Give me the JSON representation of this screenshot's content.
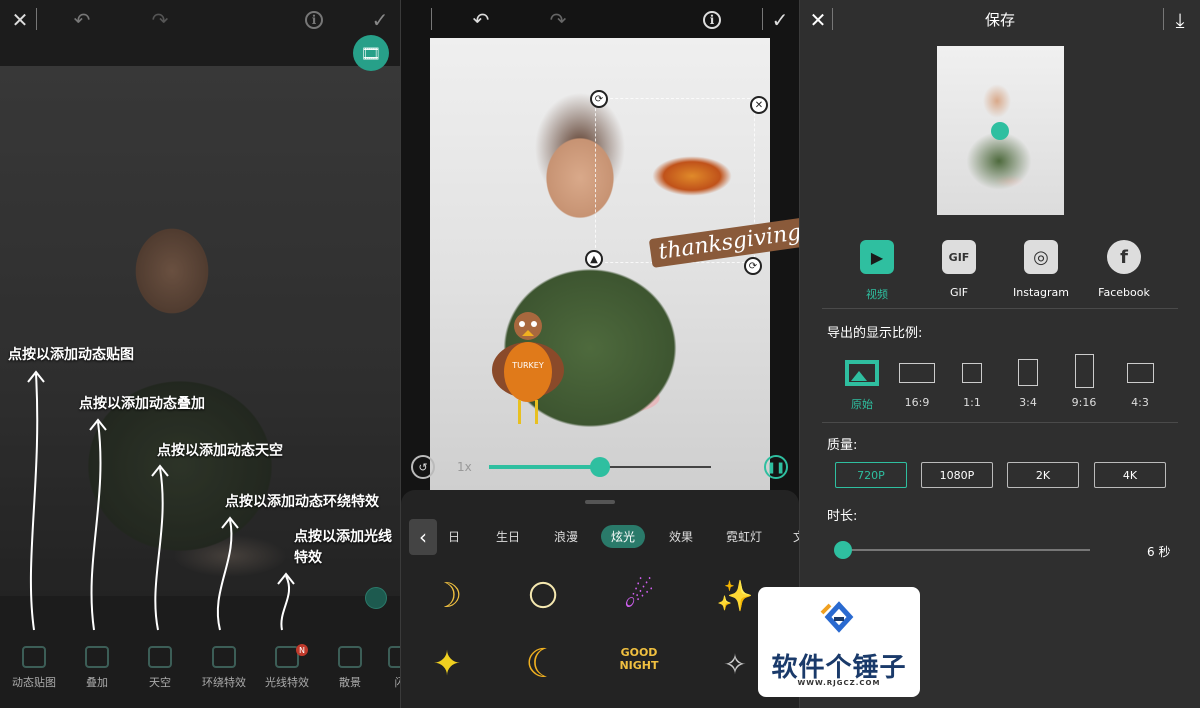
{
  "panel1": {
    "tips": [
      "点按以添加动态贴图",
      "点按以添加动态叠加",
      "点按以添加动态天空",
      "点按以添加动态环绕特效",
      "点按以添加光线",
      "特效"
    ],
    "tools": [
      "动态贴图",
      "叠加",
      "天空",
      "环绕特效",
      "光线特效",
      "散景",
      "闪"
    ],
    "new_badge": "N"
  },
  "panel2": {
    "speed_label": "1x",
    "slider_progress": 0.5,
    "sticker_text": "thanksgiving",
    "turkey_shirt_text": "TURKEY",
    "categories": [
      "日",
      "生日",
      "浪漫",
      "炫光",
      "效果",
      "霓虹灯",
      "文"
    ],
    "active_category": "炫光",
    "stickers": [
      "☽",
      "🌕",
      "☄",
      "✨",
      "✦",
      "☾",
      "🌙",
      "✧"
    ],
    "good_night_text": "GOOD NIGHT"
  },
  "panel3": {
    "title": "保存",
    "formats": [
      {
        "label": "视频",
        "icon": "video-icon",
        "active": true
      },
      {
        "label": "GIF",
        "icon": "gif-icon",
        "active": false
      },
      {
        "label": "Instagram",
        "icon": "instagram-icon",
        "active": false
      },
      {
        "label": "Facebook",
        "icon": "facebook-icon",
        "active": false
      }
    ],
    "ratio_label": "导出的显示比例:",
    "ratios": [
      "原始",
      "16:9",
      "1:1",
      "3:4",
      "9:16",
      "4:3"
    ],
    "active_ratio": "原始",
    "quality_label": "质量:",
    "qualities": [
      "720P",
      "1080P",
      "2K",
      "4K"
    ],
    "active_quality": "720P",
    "duration_label": "时长:",
    "duration_value": "6 秒"
  },
  "watermark": {
    "name": "软件个锤子",
    "url": "WWW.RJGCZ.COM"
  },
  "colors": {
    "accent": "#2fbfa0",
    "panel_bg": "#2f2f2f"
  }
}
